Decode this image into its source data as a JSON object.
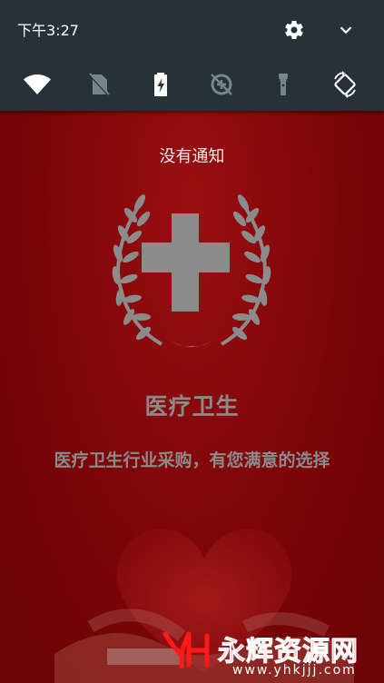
{
  "status_bar": {
    "time": "下午3:27"
  },
  "quick_settings": {
    "tiles": [
      {
        "icon": "wifi-icon"
      },
      {
        "icon": "no-sim-icon"
      },
      {
        "icon": "battery-charging-icon"
      },
      {
        "icon": "data-saver-off-icon"
      },
      {
        "icon": "flashlight-icon"
      },
      {
        "icon": "auto-rotate-icon"
      }
    ],
    "settings_icon": "gear-icon",
    "expand_icon": "chevron-down-icon"
  },
  "notifications": {
    "empty_label": "没有通知"
  },
  "splash": {
    "title": "医疗卫生",
    "slogan": "医疗卫生行业采购，有您满意的选择"
  },
  "watermark": {
    "name": "永辉资源网",
    "url": "www.yhkjjj.com"
  },
  "colors": {
    "shade": "#263238",
    "background_red": "#7a0507",
    "emblem_gray": "#8b8b8b",
    "watermark_red": "#ff1a1a"
  }
}
